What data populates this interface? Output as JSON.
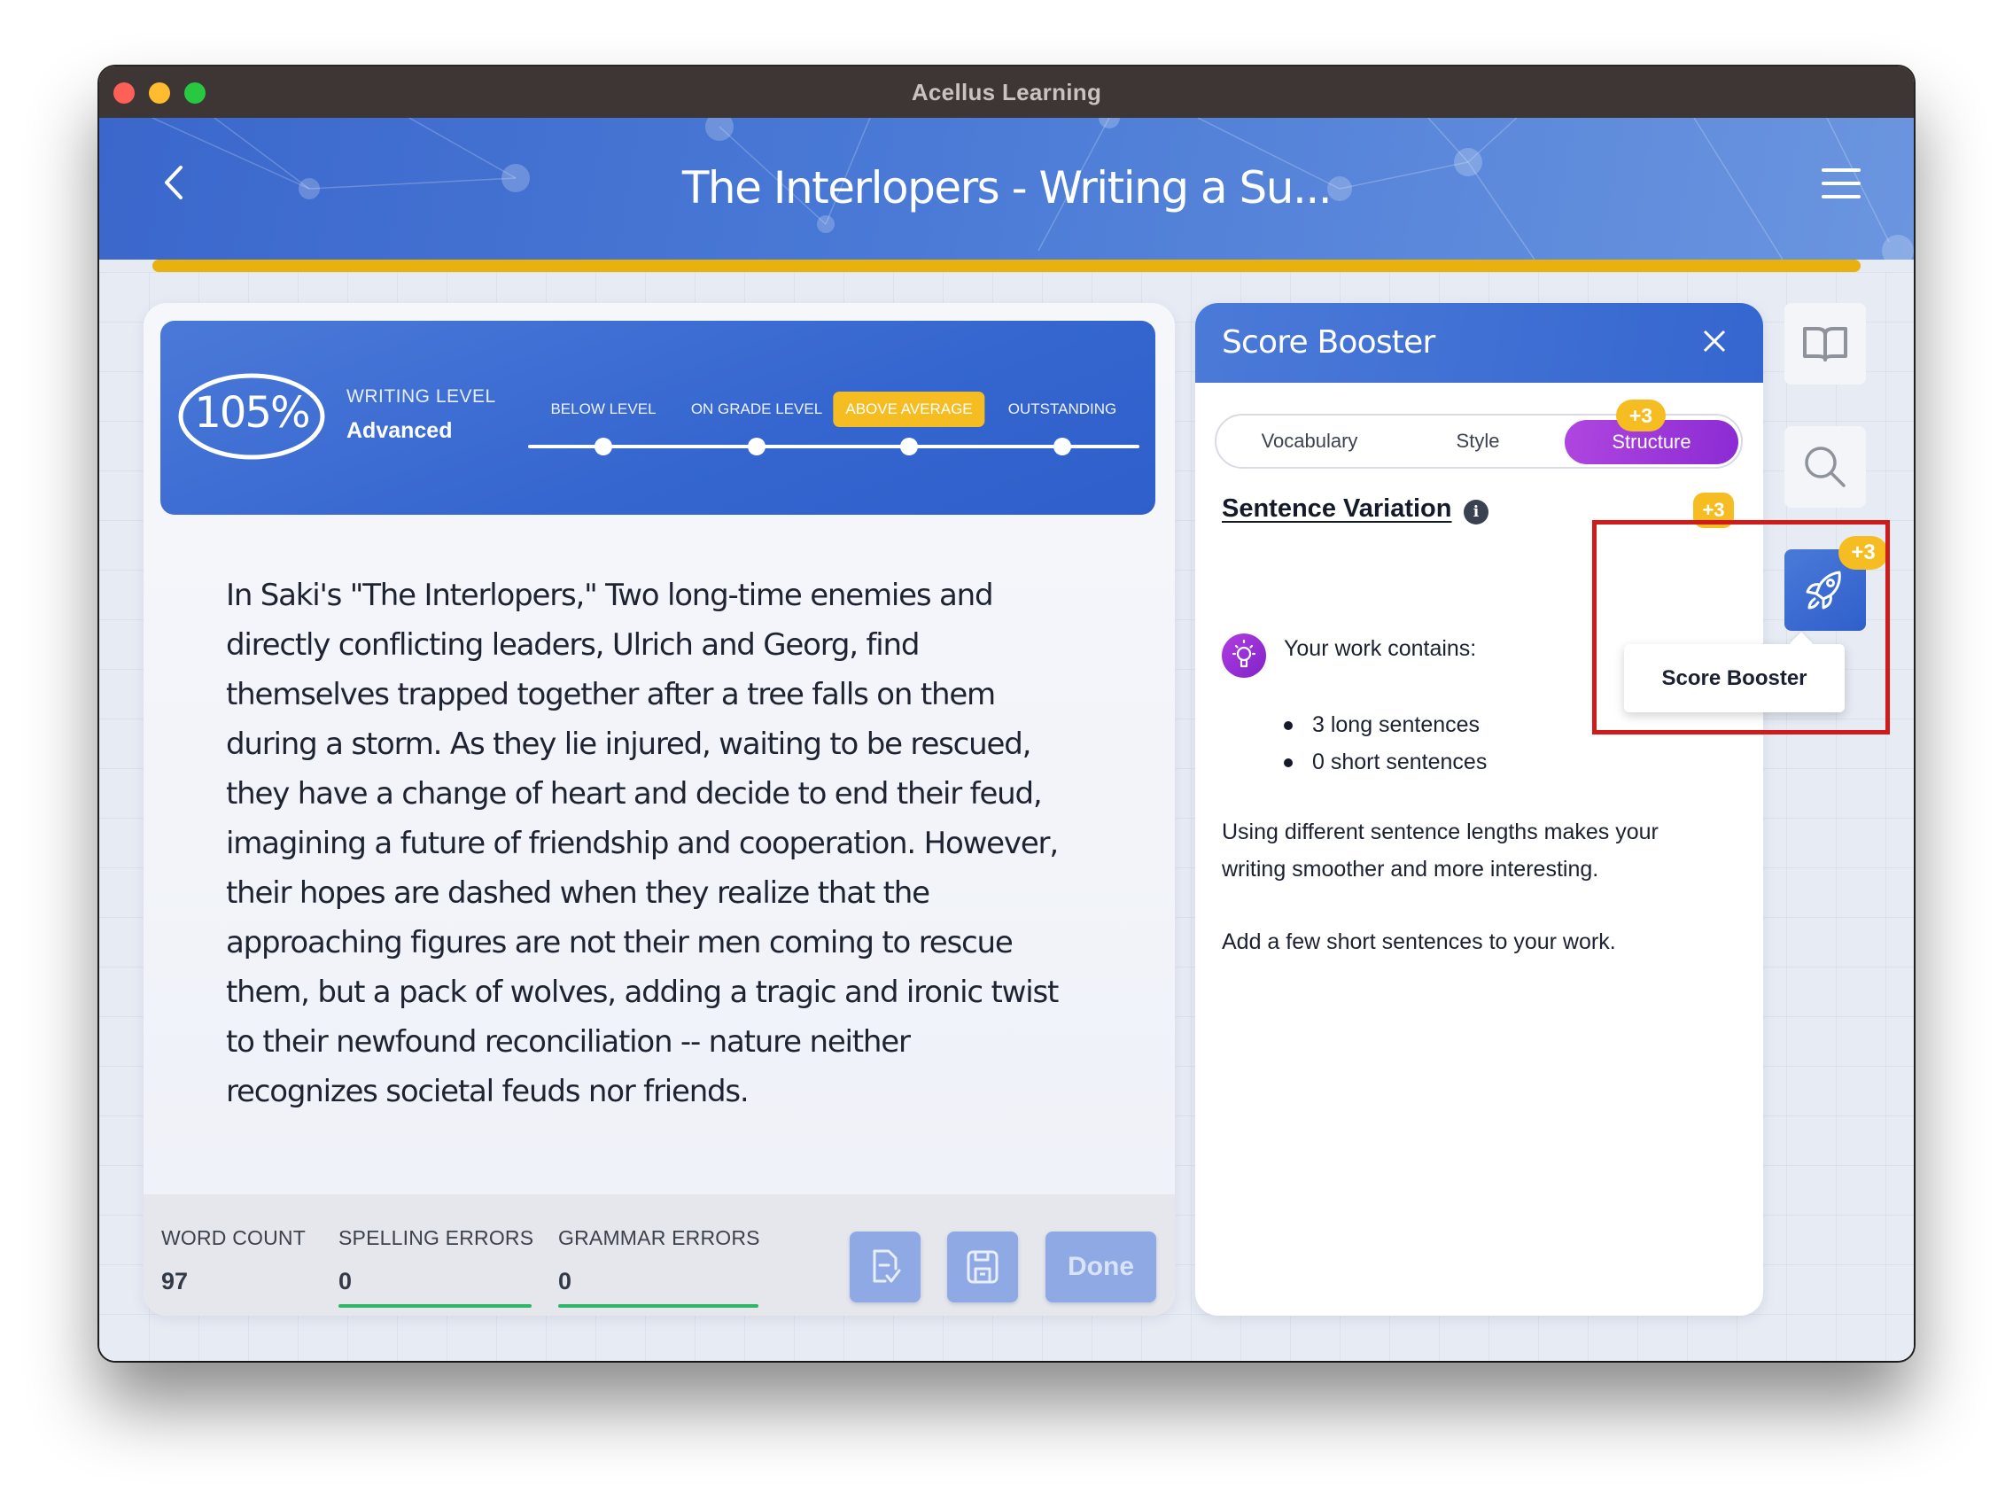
{
  "window": {
    "title": "Acellus Learning"
  },
  "header": {
    "lesson_title": "The Interlopers - Writing a Su...",
    "progress_percent": 100
  },
  "writing_level": {
    "score": "105%",
    "label": "WRITING LEVEL",
    "value": "Advanced",
    "scale": [
      {
        "label": "BELOW LEVEL",
        "active": false
      },
      {
        "label": "ON GRADE LEVEL",
        "active": false
      },
      {
        "label": "ABOVE AVERAGE",
        "active": true
      },
      {
        "label": "OUTSTANDING",
        "active": false
      }
    ]
  },
  "essay": {
    "lines": [
      "In Saki's \"The Interlopers,\" Two long-time enemies and",
      "directly conflicting leaders, Ulrich and Georg, find",
      "themselves trapped together after a tree falls on them",
      "during a storm. As they lie injured, waiting to be rescued,",
      "they have a change of heart and decide to end their feud,",
      "imagining a future of friendship and cooperation. However,",
      "their hopes are dashed when they realize that the",
      "approaching figures are not their men coming to rescue",
      "them, but a pack of wolves, adding a tragic and ironic twist",
      "to their newfound reconciliation -- nature neither",
      "recognizes societal feuds nor friends."
    ]
  },
  "footer": {
    "word_count_label": "WORD COUNT",
    "word_count": "97",
    "spelling_label": "SPELLING ERRORS",
    "spelling_errors": "0",
    "grammar_label": "GRAMMAR ERRORS",
    "grammar_errors": "0",
    "done_label": "Done"
  },
  "score_booster": {
    "title": "Score Booster",
    "tabs": [
      {
        "label": "Vocabulary",
        "active": false
      },
      {
        "label": "Style",
        "active": false
      },
      {
        "label": "Structure",
        "active": true,
        "badge": "+3"
      }
    ],
    "section_title": "Sentence Variation",
    "section_badge": "+3",
    "intro": "Your work contains:",
    "items": [
      "3 long sentences",
      "0 short sentences"
    ],
    "paragraph1": "Using different sentence lengths makes your writing smoother and more interesting.",
    "paragraph2": "Add a few short sentences to your work."
  },
  "side_tools": {
    "rocket_badge": "+3",
    "tooltip": "Score Booster"
  },
  "colors": {
    "brand_blue": "#3566cf",
    "progress_yellow": "#e9b10d",
    "badge_yellow": "#f6bd22",
    "active_purple": "#9a33d9",
    "success_green": "#2fb765",
    "highlight_red": "#d11a1a"
  }
}
